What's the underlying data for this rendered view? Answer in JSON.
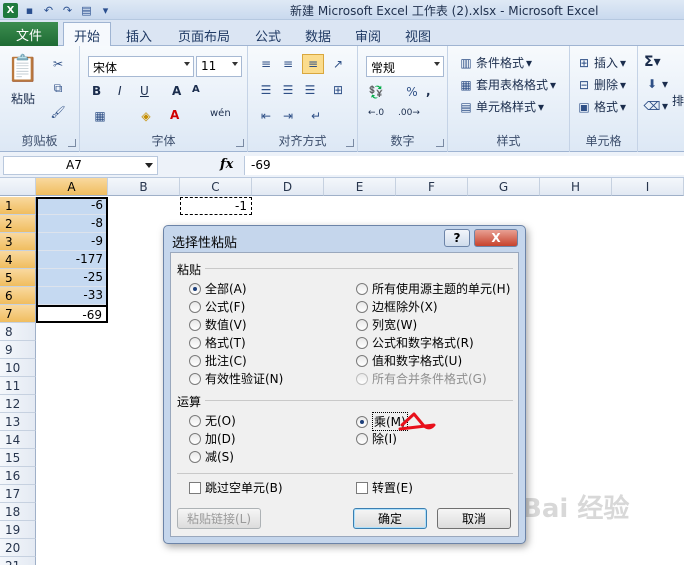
{
  "window": {
    "title": "新建 Microsoft Excel 工作表 (2).xlsx  -  Microsoft Excel"
  },
  "ribbon": {
    "file_tab": "文件",
    "tabs": [
      "开始",
      "插入",
      "页面布局",
      "公式",
      "数据",
      "审阅",
      "视图"
    ],
    "clipboard": {
      "paste": "粘贴",
      "group": "剪贴板"
    },
    "font": {
      "name": "宋体",
      "size": "11",
      "group": "字体"
    },
    "align": {
      "group": "对齐方式"
    },
    "number": {
      "format": "常规",
      "group": "数字"
    },
    "styles": {
      "cond": "条件格式",
      "table": "套用表格格式",
      "cell": "单元格样式",
      "group": "样式"
    },
    "cells": {
      "insert": "插入",
      "delete": "删除",
      "format": "格式",
      "group": "单元格"
    },
    "edit": {
      "partial": "排"
    }
  },
  "formula": {
    "namebox": "A7",
    "fx": "fx",
    "value": "-69"
  },
  "sheet": {
    "columns": [
      "A",
      "B",
      "C",
      "D",
      "E",
      "F",
      "G",
      "H",
      "I"
    ],
    "rows": [
      "1",
      "2",
      "3",
      "4",
      "5",
      "6",
      "7",
      "8",
      "9",
      "10",
      "11",
      "12",
      "13",
      "14",
      "15",
      "16",
      "17",
      "18",
      "19",
      "20",
      "21"
    ],
    "a_values": [
      "-6",
      "-8",
      "-9",
      "-177",
      "-25",
      "-33",
      "-69"
    ],
    "c1": "-1"
  },
  "dialog": {
    "title": "选择性粘贴",
    "help": "?",
    "close": "X",
    "paste_section": "粘贴",
    "paste_left": [
      "全部(A)",
      "公式(F)",
      "数值(V)",
      "格式(T)",
      "批注(C)",
      "有效性验证(N)"
    ],
    "paste_right": [
      "所有使用源主题的单元(H)",
      "边框除外(X)",
      "列宽(W)",
      "公式和数字格式(R)",
      "值和数字格式(U)",
      "所有合并条件格式(G)"
    ],
    "op_section": "运算",
    "op_left": [
      "无(O)",
      "加(D)",
      "减(S)"
    ],
    "op_right": [
      "乘(M)",
      "除(I)"
    ],
    "skip_blanks": "跳过空单元(B)",
    "transpose": "转置(E)",
    "paste_link": "粘贴链接(L)",
    "ok": "确定",
    "cancel": "取消"
  },
  "watermark": "Bai 经验",
  "colors": {
    "file_tab": "#1e6b34",
    "selection": "#c5d9f1",
    "annotation": "#e8101b"
  }
}
